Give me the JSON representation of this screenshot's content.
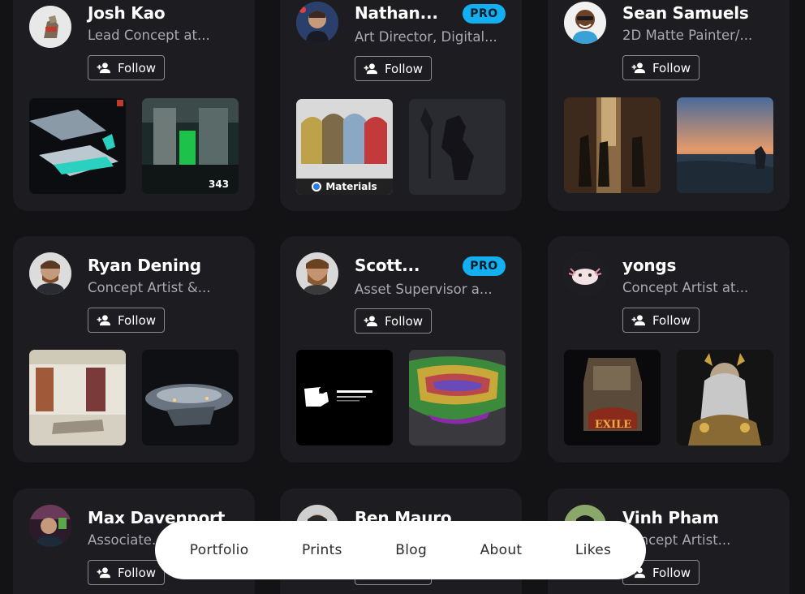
{
  "follow_label": "Follow",
  "pro_label": "PRO",
  "artists": [
    {
      "name": "Josh Kao",
      "title": "Lead Concept at...",
      "pro": false,
      "thumb_label": ""
    },
    {
      "name": "Nathan...",
      "title": "Art Director, Digital...",
      "pro": true,
      "thumb_label": "Materials"
    },
    {
      "name": "Sean Samuels",
      "title": "2D Matte Painter/...",
      "pro": false,
      "thumb_label": ""
    },
    {
      "name": "Ryan Dening",
      "title": "Concept Artist &...",
      "pro": false,
      "thumb_label": ""
    },
    {
      "name": "Scott...",
      "title": "Asset Supervisor a...",
      "pro": true,
      "thumb_label": ""
    },
    {
      "name": "yongs",
      "title": "Concept Artist at...",
      "pro": false,
      "thumb_label": ""
    },
    {
      "name": "Max Davenport",
      "title": "Associate...",
      "pro": false,
      "thumb_label": ""
    },
    {
      "name": "Ben Mauro",
      "title": "",
      "pro": false,
      "thumb_label": ""
    },
    {
      "name": "Vinh Pham",
      "title": "Concept Artist...",
      "pro": false,
      "thumb_label": ""
    }
  ],
  "nav": {
    "portfolio": "Portfolio",
    "prints": "Prints",
    "blog": "Blog",
    "about": "About",
    "likes": "Likes"
  },
  "colors": {
    "background": "#131316",
    "card": "#1c1c21",
    "pro_badge": "#13aff0"
  }
}
